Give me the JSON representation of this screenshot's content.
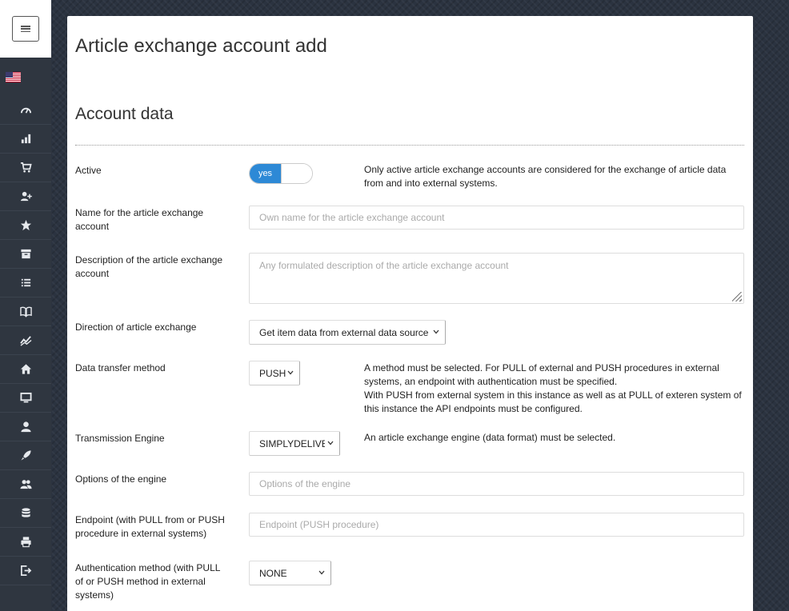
{
  "page": {
    "title": "Article exchange account add",
    "section_title": "Account data"
  },
  "sidebar": {
    "language_flag": "us-flag-icon",
    "items": [
      {
        "icon": "dashboard-icon"
      },
      {
        "icon": "bar-chart-icon"
      },
      {
        "icon": "cart-icon"
      },
      {
        "icon": "user-plus-icon"
      },
      {
        "icon": "star-icon"
      },
      {
        "icon": "archive-icon"
      },
      {
        "icon": "list-icon"
      },
      {
        "icon": "book-icon"
      },
      {
        "icon": "line-chart-icon"
      },
      {
        "icon": "home-icon"
      },
      {
        "icon": "monitor-icon"
      },
      {
        "icon": "user-icon"
      },
      {
        "icon": "rocket-icon"
      },
      {
        "icon": "users-icon"
      },
      {
        "icon": "database-icon"
      },
      {
        "icon": "printer-icon"
      },
      {
        "icon": "logout-icon"
      }
    ]
  },
  "form": {
    "active": {
      "label": "Active",
      "toggle_text": "yes",
      "toggle_on": true,
      "help": "Only active article exchange accounts are considered for the exchange of article data from and into external systems.",
      "accent": "#2d89d6"
    },
    "name": {
      "label": "Name for the article exchange account",
      "placeholder": "Own name for the article exchange account",
      "value": ""
    },
    "description": {
      "label": "Description of the article exchange account",
      "placeholder": "Any formulated description of the article exchange account",
      "value": ""
    },
    "direction": {
      "label": "Direction of article exchange",
      "selected": "Get item data from external data source"
    },
    "transfer_method": {
      "label": "Data transfer method",
      "selected": "PUSH",
      "help_line1": "A method must be selected. For PULL of external and PUSH procedures in external systems, an endpoint with authentication must be specified.",
      "help_line2": "With PUSH from external system in this instance as well as at PULL of exteren system of this instance the API endpoints must be configured."
    },
    "engine": {
      "label": "Transmission Engine",
      "selected": "SIMPLYDELIVERY",
      "help": "An article exchange engine (data format) must be selected."
    },
    "engine_options": {
      "label": "Options of the engine",
      "placeholder": "Options of the engine",
      "value": ""
    },
    "endpoint": {
      "label": "Endpoint (with PULL from or PUSH procedure in external systems)",
      "placeholder": "Endpoint (PUSH procedure)",
      "value": ""
    },
    "auth_method": {
      "label": "Authentication method (with PULL of or PUSH method in external systems)",
      "selected": "NONE"
    }
  }
}
